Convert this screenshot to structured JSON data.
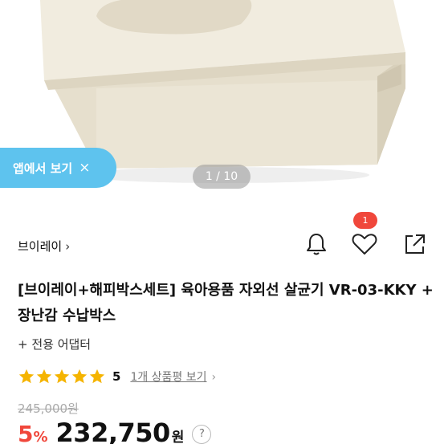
{
  "banner": {
    "label": "앱에서 보기",
    "close": "×"
  },
  "pager": {
    "text": "1 / 10"
  },
  "brand": {
    "name": "브이레이",
    "chevron": "›"
  },
  "actions": {
    "notify_icon": "bell-icon",
    "like_icon": "heart-icon",
    "like_count": "1",
    "share_icon": "share-icon"
  },
  "product": {
    "title": "[브이레이+해피박스세트] 육아용품 자외선 살균기 VR-03-KKY + 장난감 수납박스",
    "option": "+ 전용 어댑터"
  },
  "rating": {
    "stars": 5,
    "score": "5",
    "review_link": "1개 상품평 보기",
    "chevron": "›",
    "star_color": "#f5b400"
  },
  "price": {
    "original": "245,000원",
    "discount": "5",
    "discount_unit": "%",
    "sale": "232,750",
    "won": "원",
    "help": "?"
  },
  "colors": {
    "accent": "#5ec3ee",
    "discount": "#f0473b",
    "badge": "#f0473b",
    "product": "#ece6d6"
  }
}
